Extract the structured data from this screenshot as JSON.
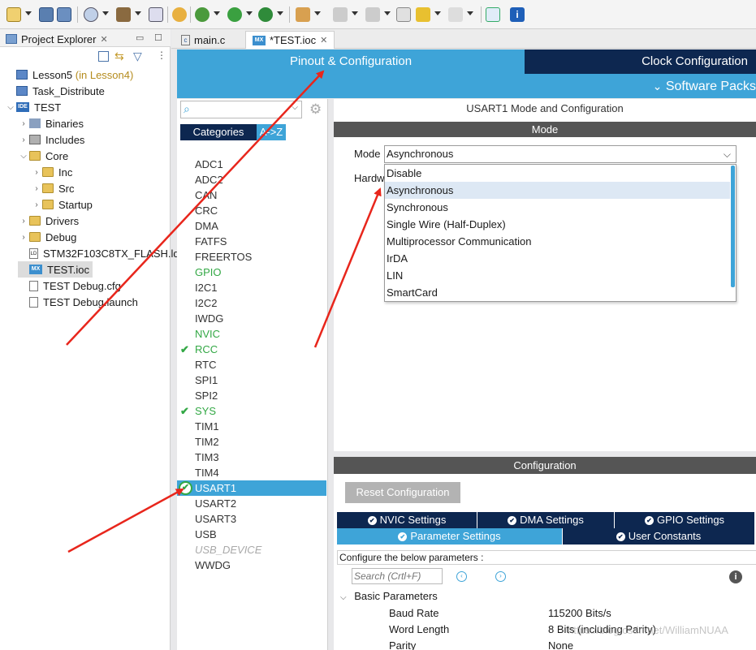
{
  "toolbar": {
    "icons": [
      "new-icon",
      "save-icon",
      "save-all-icon",
      "settings-icon",
      "build-icon",
      "build-config-icon",
      "binary-icon",
      "hand-icon",
      "debug-icon",
      "run-icon",
      "external-tool-icon",
      "link-icon",
      "annotation-icon",
      "annotation-prev-icon",
      "back-icon",
      "forward-icon",
      "open-perspective-icon",
      "info-icon"
    ]
  },
  "project_explorer": {
    "tab_label": "Project Explorer",
    "items": [
      {
        "label": "Lesson5",
        "note": "(in Lesson4)"
      },
      {
        "label": "Task_Distribute"
      },
      {
        "label": "TEST",
        "badge": "IDE"
      },
      {
        "label": "Binaries"
      },
      {
        "label": "Includes"
      },
      {
        "label": "Core"
      },
      {
        "label": "Inc"
      },
      {
        "label": "Src"
      },
      {
        "label": "Startup"
      },
      {
        "label": "Drivers"
      },
      {
        "label": "Debug"
      },
      {
        "label": "STM32F103C8TX_FLASH.ld",
        "badge": "LD"
      },
      {
        "label": "TEST.ioc",
        "badge": "MX"
      },
      {
        "label": "TEST Debug.cfg"
      },
      {
        "label": "TEST Debug.launch"
      }
    ]
  },
  "editor_tabs": [
    {
      "label": "main.c",
      "badge": "c"
    },
    {
      "label": "*TEST.ioc",
      "badge": "MX"
    }
  ],
  "header": {
    "pinout": "Pinout & Configuration",
    "clock": "Clock Configuration",
    "software_packs": "Software Packs"
  },
  "peripherals": {
    "search_placeholder": "",
    "tab_categories": "Categories",
    "tab_az": "A->Z",
    "items": [
      {
        "label": "ADC1"
      },
      {
        "label": "ADC2"
      },
      {
        "label": "CAN"
      },
      {
        "label": "CRC"
      },
      {
        "label": "DMA"
      },
      {
        "label": "FATFS"
      },
      {
        "label": "FREERTOS"
      },
      {
        "label": "GPIO"
      },
      {
        "label": "I2C1"
      },
      {
        "label": "I2C2"
      },
      {
        "label": "IWDG"
      },
      {
        "label": "NVIC"
      },
      {
        "label": "RCC"
      },
      {
        "label": "RTC"
      },
      {
        "label": "SPI1"
      },
      {
        "label": "SPI2"
      },
      {
        "label": "SYS"
      },
      {
        "label": "TIM1"
      },
      {
        "label": "TIM2"
      },
      {
        "label": "TIM3"
      },
      {
        "label": "TIM4"
      },
      {
        "label": "USART1"
      },
      {
        "label": "USART2"
      },
      {
        "label": "USART3"
      },
      {
        "label": "USB"
      },
      {
        "label": "USB_DEVICE"
      },
      {
        "label": "WWDG"
      }
    ]
  },
  "mode_panel": {
    "title": "USART1 Mode and Configuration",
    "mode_section": "Mode",
    "mode_label": "Mode",
    "mode_value": "Asynchronous",
    "hw_label": "Hardw",
    "options": [
      "Disable",
      "Asynchronous",
      "Synchronous",
      "Single Wire (Half-Duplex)",
      "Multiprocessor Communication",
      "IrDA",
      "LIN",
      "SmartCard"
    ]
  },
  "config_panel": {
    "section": "Configuration",
    "reset_button": "Reset Configuration",
    "tabs_row1": [
      "NVIC Settings",
      "DMA Settings",
      "GPIO Settings"
    ],
    "tabs_row2": [
      "Parameter Settings",
      "User Constants"
    ],
    "description": "Configure the below parameters :",
    "search_placeholder": "Search (Crtl+F)",
    "group": "Basic Parameters",
    "params": [
      {
        "name": "Baud Rate",
        "value": "115200 Bits/s"
      },
      {
        "name": "Word Length",
        "value": "8 Bits (including Parity)"
      },
      {
        "name": "Parity",
        "value": "None"
      }
    ],
    "watermark": "https://blog.csdn.net/WilliamNUAA"
  },
  "colors": {
    "accent_blue": "#3ea4d8",
    "dark_navy": "#0d2750",
    "check_green": "#33a845",
    "arrow_red": "#e8261c"
  }
}
